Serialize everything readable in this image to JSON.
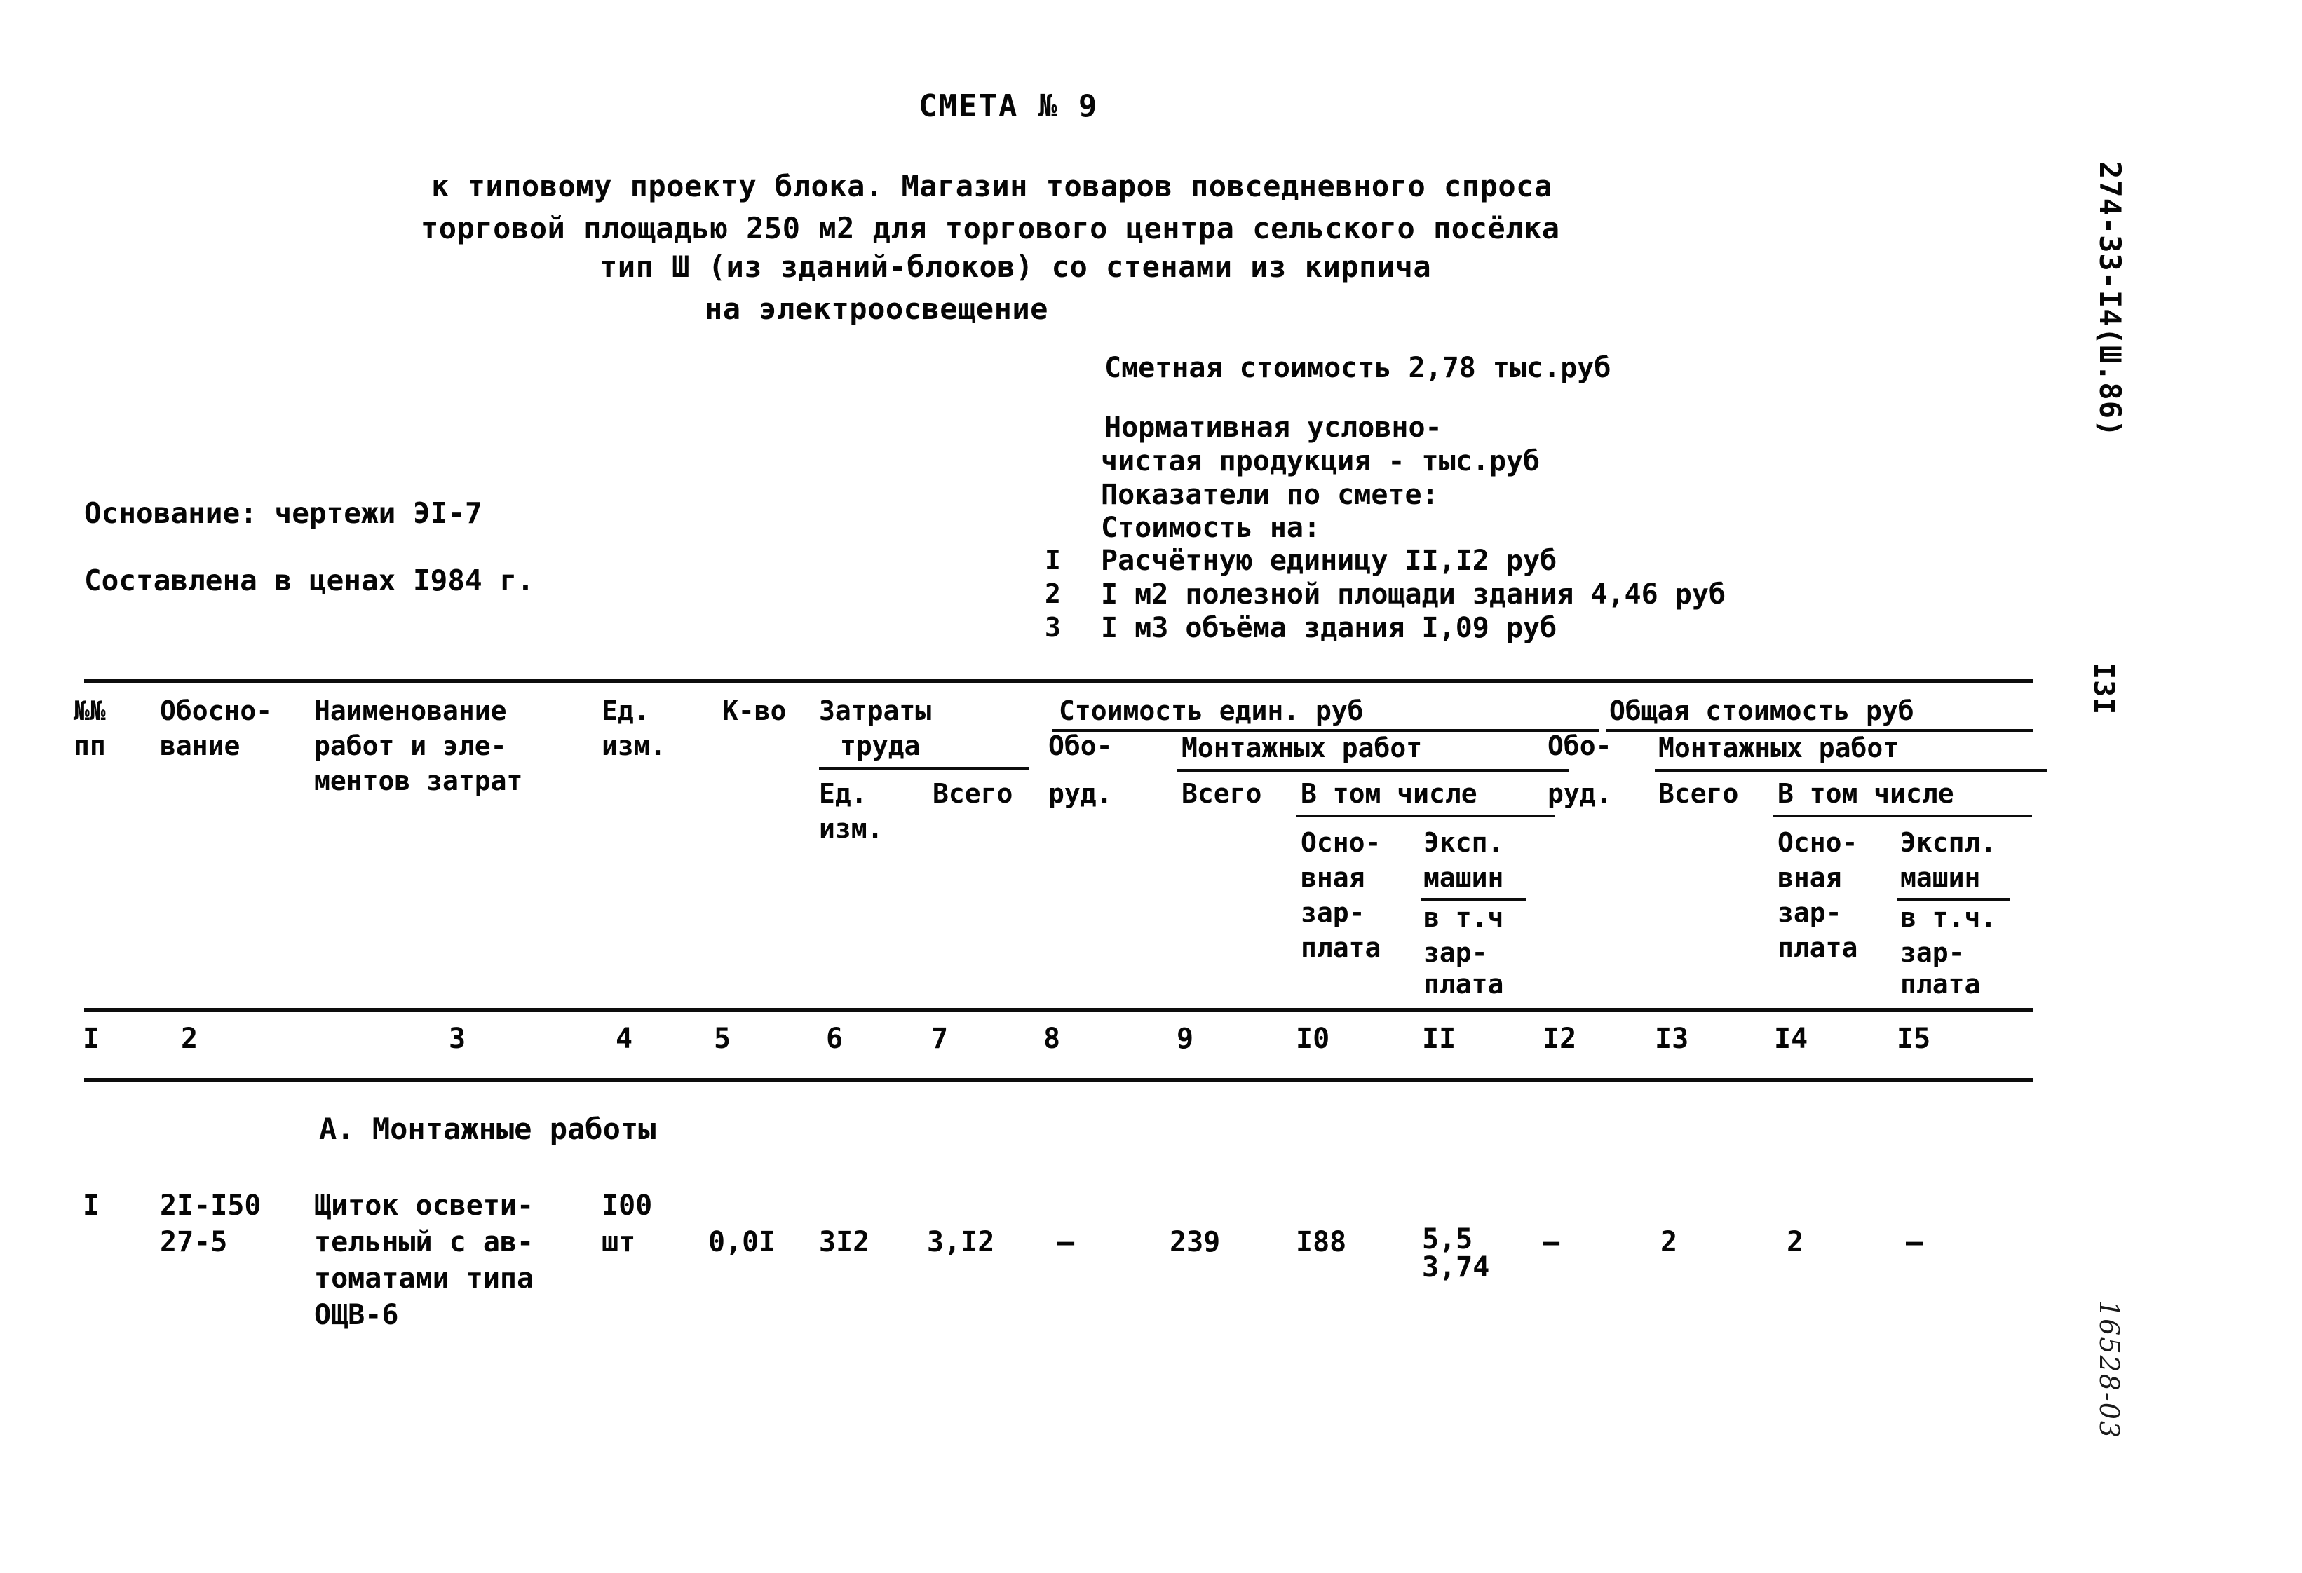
{
  "document": {
    "title": "СМЕТА № 9",
    "subtitle_lines": [
      "к типовому проекту блока. Магазин товаров повседневного спроса",
      "торговой площадью 250 м2 для торгового центра сельского посёлка",
      "тип Ш (из зданий-блоков) со стенами из кирпича",
      "на электроосвещение"
    ],
    "code_vertical": "274-33-I4(Ш.86)",
    "page_number_vertical": "I3I",
    "archive_number_vertical": "16528-03"
  },
  "basis": {
    "line1": "Основание: чертежи ЭI-7",
    "line2": "Составлена в ценах I984 г."
  },
  "summary": {
    "estimate_cost": "Сметная стоимость 2,78 тыс.руб",
    "normative_line1": "Нормативная условно-",
    "normative_line2": "чистая продукция - тыс.руб",
    "indicators_label": "Показатели по смете:",
    "cost_for_label": "Стоимость на:",
    "items": [
      {
        "no": "I",
        "text": "Расчётную единицу II,I2 руб"
      },
      {
        "no": "2",
        "text": "I м2 полезной площади здания 4,46 руб"
      },
      {
        "no": "3",
        "text": "I м3 объёма здания I,09 руб"
      }
    ]
  },
  "table": {
    "headers": {
      "col1_l1": "№№",
      "col1_l2": "пп",
      "col2_l1": "Обосно-",
      "col2_l2": "вание",
      "col3_l1": "Наименование",
      "col3_l2": "работ и эле-",
      "col3_l3": "ментов затрат",
      "col4_l1": "Ед.",
      "col4_l2": "изм.",
      "col5": "К-во",
      "col6_group_l1": "Затраты",
      "col6_group_l2": "труда",
      "col6_sub_l1": "Ед.",
      "col6_sub_l2": "изм.",
      "col7_sub": "Всего",
      "unit_cost_group": "Стоимость един. руб",
      "col8_l1": "Обо-",
      "col8_l2": "руд.",
      "mounting_works_mid": "Монтажных работ",
      "col9_sub": "Всего",
      "in_that_number_mid": "В том числе",
      "col10_l1": "Осно-",
      "col10_l2": "вная",
      "col10_l3": "зар-",
      "col10_l4": "плата",
      "col11_l1": "Эксп.",
      "col11_l2": "машин",
      "col11_l3": "в т.ч",
      "col11_l4": "зар-",
      "col11_l5": "плата",
      "total_cost_group": "Общая стоимость руб",
      "col12_l1": "Обо-",
      "col12_l2": "руд.",
      "mounting_works_right": "Монтажных работ",
      "col13_sub": "Всего",
      "in_that_number_right": "В том числе",
      "col14_l1": "Осно-",
      "col14_l2": "вная",
      "col14_l3": "зар-",
      "col14_l4": "плата",
      "col15_l1": "Экспл.",
      "col15_l2": "машин",
      "col15_l3": "в т.ч.",
      "col15_l4": "зар-",
      "col15_l5": "плата"
    },
    "column_numbers": [
      "I",
      "2",
      "3",
      "4",
      "5",
      "6",
      "7",
      "8",
      "9",
      "I0",
      "II",
      "I2",
      "I3",
      "I4",
      "I5"
    ],
    "section_heading": "А. Монтажные работы",
    "rows": [
      {
        "no": "I",
        "basis_l1": "2I-I50",
        "basis_l2": "27-5",
        "name_l1": "Щиток освети-",
        "name_l2": "тельный с ав-",
        "name_l3": "томатами типа",
        "name_l4": "ОЩВ-6",
        "unit_l1": "I00",
        "unit_l2": "шт",
        "qty": "0,0I",
        "labor_unit": "3I2",
        "labor_total": "3,I2",
        "unit_equipment": "–",
        "unit_mount_total": "239",
        "unit_main_salary": "I88",
        "unit_mach_num": "5,5",
        "unit_mach_den": "3,74",
        "total_equipment": "–",
        "total_mount_total": "2",
        "total_main_salary": "2",
        "total_mach": "–"
      }
    ]
  }
}
